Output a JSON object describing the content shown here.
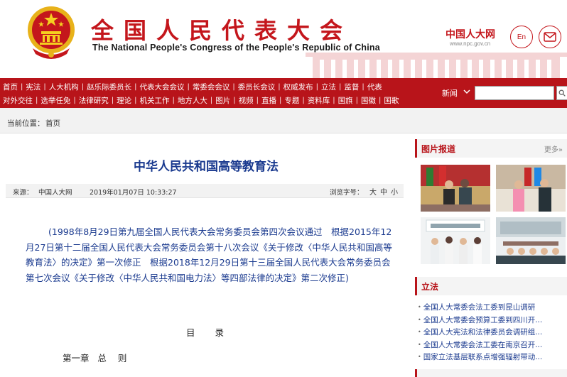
{
  "header": {
    "title_cn": "全国人民代表大会",
    "title_en": "The National People's Congress of the People's Republic of China",
    "site_logo": "中国人大网",
    "site_url": "www.npc.gov.cn",
    "en_label": "En",
    "icons": {
      "emblem": "national-emblem-icon",
      "mail": "mail-icon"
    }
  },
  "nav": {
    "row1": [
      "首页",
      "宪法",
      "人大机构",
      "赵乐际委员长",
      "代表大会会议",
      "常委会会议",
      "委员长会议",
      "权威发布",
      "立法",
      "监督",
      "代表"
    ],
    "row2": [
      "对外交往",
      "选举任免",
      "法律研究",
      "理论",
      "机关工作",
      "地方人大",
      "图片",
      "视频",
      "直播",
      "专题",
      "资料库",
      "国旗",
      "国徽",
      "国歌"
    ],
    "search_scope": "新闻",
    "search_value": ""
  },
  "breadcrumb": {
    "label": "当前位置：",
    "home": "首页"
  },
  "article": {
    "title": "中华人民共和国高等教育法",
    "source_label": "来源：",
    "source": "中国人大网",
    "date": "2019年01月07日  10:33:27",
    "font_label": "浏览字号：",
    "font_sizes": [
      "大",
      "中",
      "小"
    ],
    "preamble": "(1998年8月29日第九届全国人民代表大会常务委员会第四次会议通过　根据2015年12月27日第十二届全国人民代表大会常务委员会第十八次会议《关于修改〈中华人民共和国高等教育法〉的决定》第一次修正　根据2018年12月29日第十三届全国人民代表大会常务委员会第七次会议《关于修改〈中华人民共和国电力法〉等四部法律的决定》第二次修正)",
    "toc_title": "目录",
    "chapter_1": "第一章   总    则"
  },
  "sidebar": {
    "photo_section": {
      "title": "图片报道",
      "more": "更多»"
    },
    "law_section": {
      "title": "立法",
      "items": [
        "全国人大常委会法工委到昆山调研",
        "全国人大常委会预算工委到四川开...",
        "全国人大宪法和法律委员会调研组...",
        "全国人大常委会法工委在南京召开...",
        "国家立法基层联系点增强辐射带动..."
      ]
    }
  },
  "colors": {
    "brand_red": "#b8141a",
    "title_blue": "#1a3a8f"
  }
}
